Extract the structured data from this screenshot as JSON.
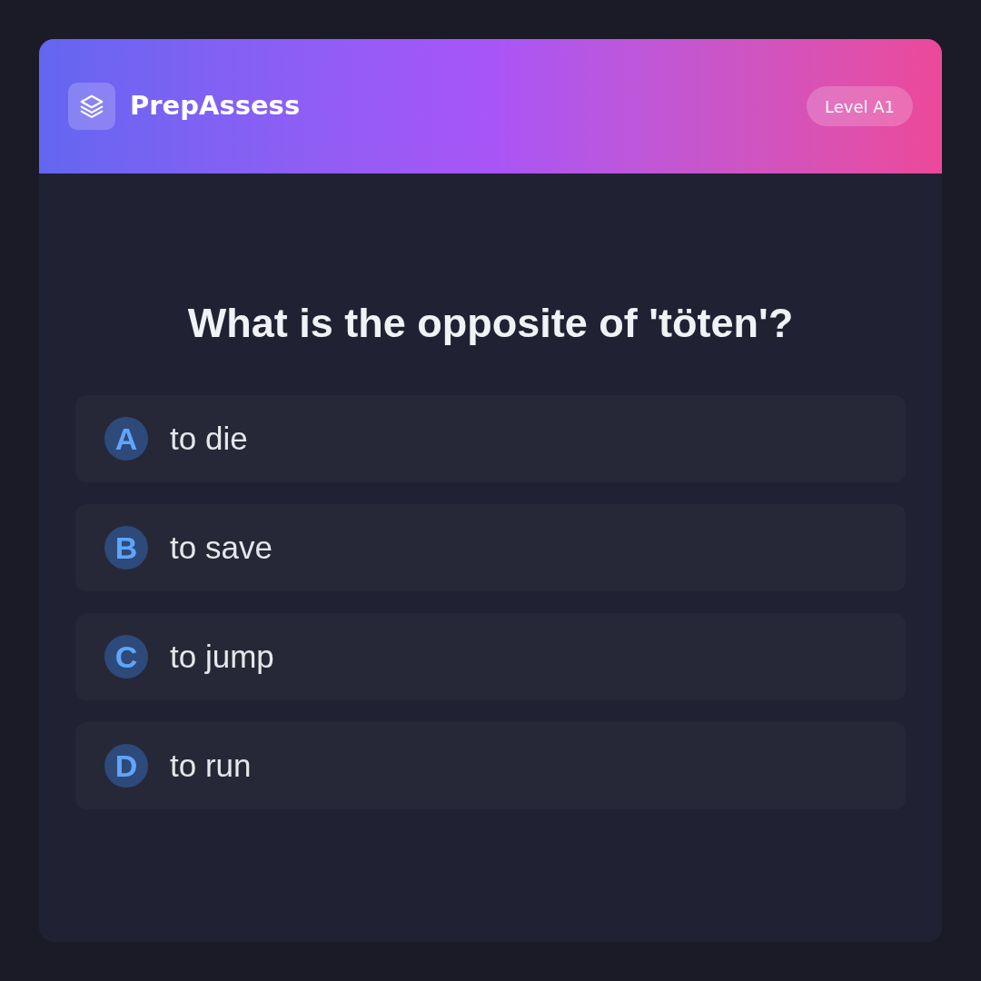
{
  "header": {
    "brand": "PrepAssess",
    "badge": "Level A1"
  },
  "question": "What is the opposite of 'töten'?",
  "options": [
    {
      "letter": "A",
      "text": "to die",
      "selected": false
    },
    {
      "letter": "B",
      "text": "to save",
      "selected": false
    },
    {
      "letter": "C",
      "text": "to jump",
      "selected": false
    },
    {
      "letter": "D",
      "text": "to run",
      "selected": false
    }
  ]
}
